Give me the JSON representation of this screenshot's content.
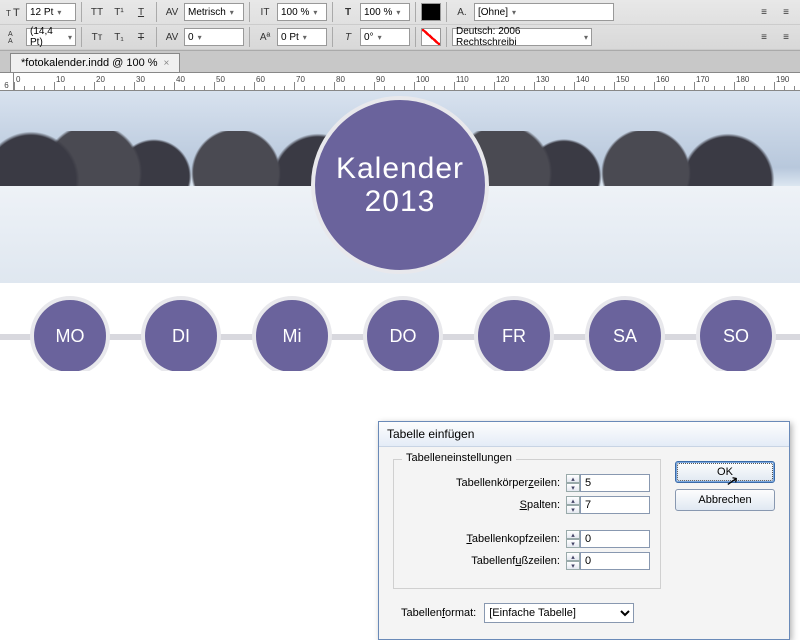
{
  "toolbar": {
    "font_size": "12 Pt",
    "leading": "(14,4 Pt)",
    "kerning": "Metrisch",
    "tracking": "0",
    "hscale": "100 %",
    "vscale": "100 %",
    "baseline": "0 Pt",
    "skew": "0°",
    "char_style": "[Ohne]",
    "lang": "Deutsch: 2006 Rechtschreibi"
  },
  "tab": {
    "title": "*fotokalender.indd @ 100 %"
  },
  "ruler": {
    "marks": [
      "0",
      "10",
      "20",
      "30",
      "40",
      "50",
      "60",
      "70",
      "80",
      "90",
      "100",
      "110",
      "120",
      "130",
      "140",
      "150",
      "160",
      "170",
      "180",
      "190"
    ],
    "gutter": "6"
  },
  "doc": {
    "title1": "Kalender",
    "title2": "2013",
    "days": [
      "MO",
      "DI",
      "Mi",
      "DO",
      "FR",
      "SA",
      "SO"
    ]
  },
  "dialog": {
    "title": "Tabelle einfügen",
    "group": "Tabelleneinstellungen",
    "body_rows_label": "Tabellenkörperzeilen:",
    "body_rows": "5",
    "cols_label": "Spalten:",
    "cols": "7",
    "head_rows_label": "Tabellenkopfzeilen:",
    "head_rows": "0",
    "foot_rows_label": "Tabellenfußzeilen:",
    "foot_rows": "0",
    "format_label": "Tabellenformat:",
    "format_value": "[Einfache Tabelle]",
    "ok": "OK",
    "cancel": "Abbrechen"
  }
}
